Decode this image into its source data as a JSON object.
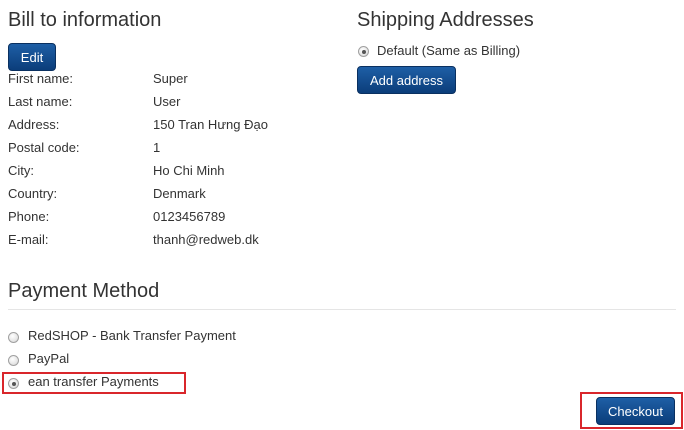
{
  "billing": {
    "title": "Bill to information",
    "edit_label": "Edit",
    "fields": [
      {
        "label": "First name:",
        "value": "Super"
      },
      {
        "label": "Last name:",
        "value": "User"
      },
      {
        "label": "Address:",
        "value": "150 Tran Hưng Đạo"
      },
      {
        "label": "Postal code:",
        "value": "1"
      },
      {
        "label": "City:",
        "value": "Ho Chi Minh"
      },
      {
        "label": "Country:",
        "value": "Denmark"
      },
      {
        "label": "Phone:",
        "value": "0123456789"
      },
      {
        "label": "E-mail:",
        "value": "thanh@redweb.dk"
      }
    ]
  },
  "shipping": {
    "title": "Shipping Addresses",
    "default_option": "Default (Same as Billing)",
    "add_label": "Add address"
  },
  "payment": {
    "title": "Payment Method",
    "options": [
      {
        "label": "RedSHOP - Bank Transfer Payment",
        "selected": false
      },
      {
        "label": "PayPal",
        "selected": false
      },
      {
        "label": "ean transfer Payments",
        "selected": true
      }
    ]
  },
  "checkout_label": "Checkout",
  "colors": {
    "button": "#0b3d7a",
    "highlight": "#d9262b"
  }
}
